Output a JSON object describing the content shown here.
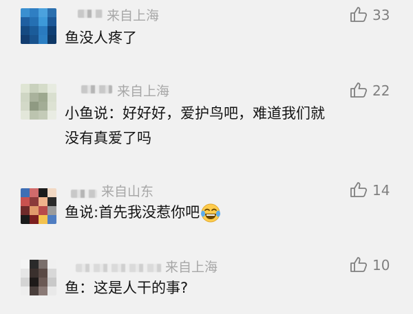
{
  "comments": [
    {
      "location": "来自上海",
      "likes": "33",
      "text": [
        "鱼没人疼了"
      ]
    },
    {
      "location": "来自上海",
      "likes": "22",
      "text": [
        "小鱼说：好好好，爱护鸟吧，难道我们就",
        "没有真爱了吗"
      ]
    },
    {
      "location": "来自山东",
      "likes": "14",
      "text": [
        "鱼说:首先我没惹你吧"
      ],
      "trailing_icon": "laughing-crying-emoji-icon"
    },
    {
      "location": "来自上海",
      "likes": "10",
      "text": [
        "鱼：这是人干的事?"
      ]
    }
  ],
  "icons": {
    "like": "thumbs-up-outline-icon"
  },
  "colors": {
    "background": "#f1f1f1",
    "text": "#141414",
    "meta": "#a7a7a7",
    "like": "#7f7f7f"
  }
}
